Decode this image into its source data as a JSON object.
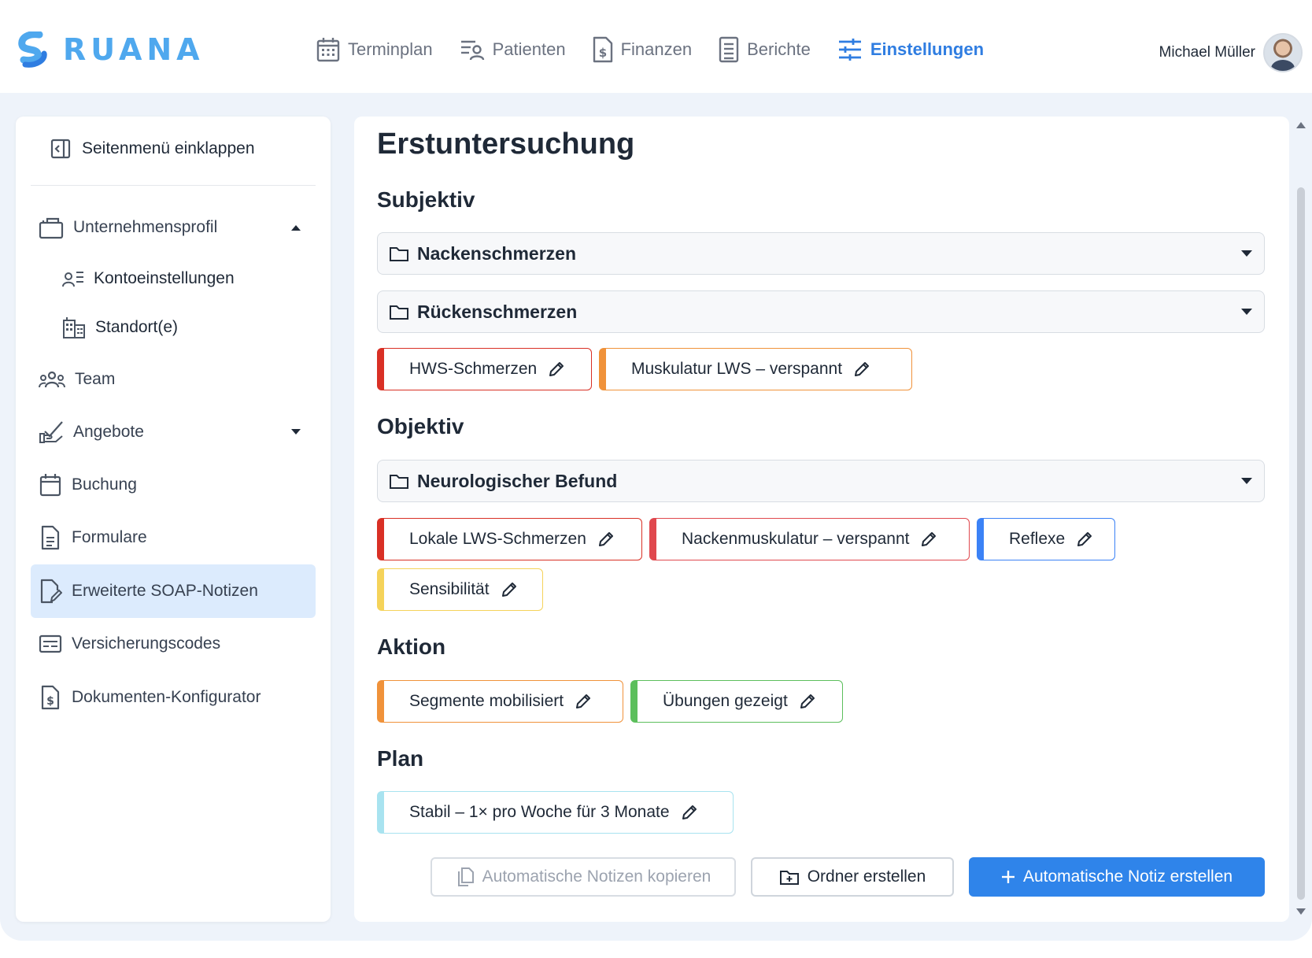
{
  "brand": {
    "name": "RUANA",
    "logo_color": "#4fa8ee"
  },
  "nav": {
    "items": [
      {
        "label": "Terminplan",
        "icon": "calendar-icon",
        "active": false
      },
      {
        "label": "Patienten",
        "icon": "patients-icon",
        "active": false
      },
      {
        "label": "Finanzen",
        "icon": "finance-document-icon",
        "active": false
      },
      {
        "label": "Berichte",
        "icon": "report-icon",
        "active": false
      },
      {
        "label": "Einstellungen",
        "icon": "sliders-icon",
        "active": true
      }
    ],
    "active_color": "#2f7de1"
  },
  "user": {
    "name": "Michael Müller"
  },
  "sidebar": {
    "collapse_label": "Seitenmenü einklappen",
    "items": [
      {
        "label": "Unternehmensprofil",
        "icon": "briefcase-icon",
        "expanded": true
      },
      {
        "label": "Kontoeinstellungen",
        "icon": "user-settings-icon",
        "sub": true
      },
      {
        "label": "Standort(e)",
        "icon": "building-icon",
        "sub": true
      },
      {
        "label": "Team",
        "icon": "team-icon"
      },
      {
        "label": "Angebote",
        "icon": "offer-hand-icon",
        "expanded": false
      },
      {
        "label": "Buchung",
        "icon": "calendar-icon"
      },
      {
        "label": "Formulare",
        "icon": "form-document-icon"
      },
      {
        "label": "Erweiterte SOAP-Notizen",
        "icon": "document-edit-icon",
        "active": true
      },
      {
        "label": "Versicherungscodes",
        "icon": "code-card-icon"
      },
      {
        "label": "Dokumenten-Konfigurator",
        "icon": "document-dollar-icon"
      }
    ]
  },
  "main": {
    "title": "Erstuntersuchung",
    "sections": {
      "subjektiv": {
        "title": "Subjektiv",
        "folders": [
          "Nackenschmerzen",
          "Rückenschmerzen"
        ],
        "tags": [
          {
            "label": "HWS-Schmerzen",
            "color": "#d93025"
          },
          {
            "label": "Muskulatur LWS – verspannt",
            "color": "#f0923a"
          }
        ]
      },
      "objektiv": {
        "title": "Objektiv",
        "folders": [
          "Neurologischer Befund"
        ],
        "tags": [
          {
            "label": "Lokale LWS-Schmerzen",
            "color": "#d93025"
          },
          {
            "label": "Nackenmuskulatur – verspannt",
            "color": "#e0484e"
          },
          {
            "label": "Reflexe",
            "color": "#3b82f6"
          },
          {
            "label": "Sensibilität",
            "color": "#f5d35a"
          }
        ]
      },
      "aktion": {
        "title": "Aktion",
        "tags": [
          {
            "label": "Segmente mobilisiert",
            "color": "#f0923a"
          },
          {
            "label": "Übungen gezeigt",
            "color": "#5cbf5c"
          }
        ]
      },
      "plan": {
        "title": "Plan",
        "tags": [
          {
            "label": "Stabil – 1× pro Woche für 3 Monate",
            "color": "#a8e3f0"
          }
        ]
      }
    },
    "actions": {
      "copy_label": "Automatische Notizen kopieren",
      "folder_label": "Ordner erstellen",
      "create_label": "Automatische Notiz erstellen"
    }
  }
}
